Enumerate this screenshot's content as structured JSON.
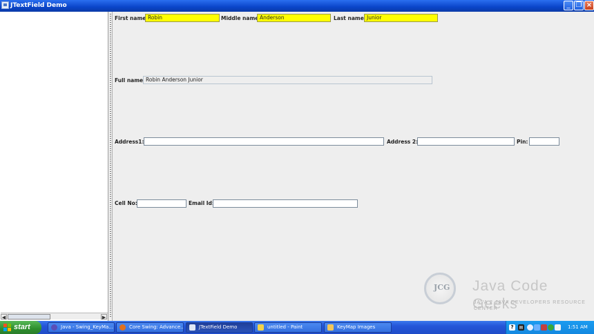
{
  "window": {
    "title": "JTextField Demo"
  },
  "form": {
    "first_name": {
      "label": "First name:",
      "value": "Robin"
    },
    "middle_name": {
      "label": "Middle name:",
      "value": "Anderson"
    },
    "last_name": {
      "label": "Last name:",
      "value": "Junior"
    },
    "full_name": {
      "label": "Full name:",
      "value": "Robin Anderson Junior"
    },
    "address1": {
      "label": "Address1:",
      "value": ""
    },
    "address2": {
      "label": "Address 2:",
      "value": ""
    },
    "pin": {
      "label": "Pin:",
      "value": ""
    },
    "cell_no": {
      "label": "Cell No:",
      "value": ""
    },
    "email_id": {
      "label": "Email Id:",
      "value": ""
    }
  },
  "watermark": {
    "logo_text": "JCG",
    "brand": "Java Code Geeks",
    "tagline": "JAVA 2 JAVA DEVELOPERS RESOURCE CENTER"
  },
  "taskbar": {
    "start_label": "start",
    "tasks": [
      {
        "label": "Java - Swing_KeyMa...",
        "icon": "eclipse-icon"
      },
      {
        "label": "Core Swing: Advance...",
        "icon": "firefox-icon"
      },
      {
        "label": "JTextField Demo",
        "icon": "java-window-icon"
      },
      {
        "label": "untitled - Paint",
        "icon": "paint-icon"
      },
      {
        "label": "KeyMap Images",
        "icon": "folder-icon"
      }
    ],
    "clock": "1:51 AM"
  },
  "colors": {
    "highlight_field": "#ffff00",
    "titlebar": "#0a45c9",
    "taskbar": "#2455d8",
    "start_button": "#2e8f2e"
  }
}
